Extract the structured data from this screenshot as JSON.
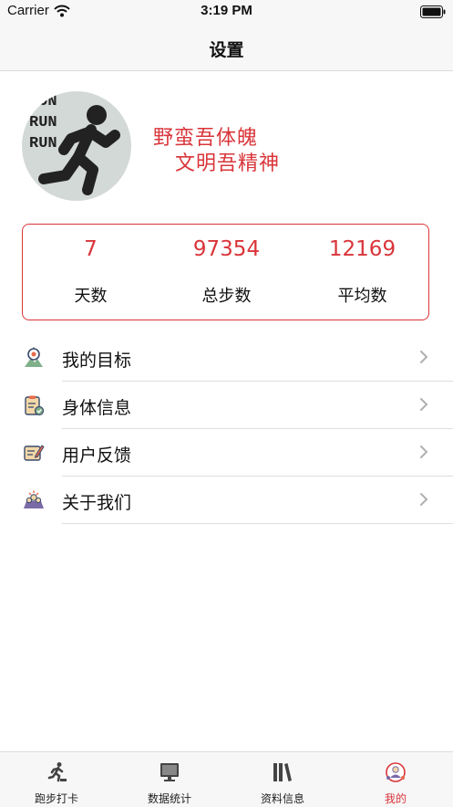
{
  "status": {
    "carrier": "Carrier",
    "time": "3:19 PM"
  },
  "nav": {
    "title": "设置"
  },
  "profile": {
    "avatar_words": [
      "RUN",
      "RUN",
      "RUN"
    ],
    "slogan_line1": "野蛮吾体魄",
    "slogan_line2": "文明吾精神"
  },
  "stats": [
    {
      "value": "7",
      "label": "天数"
    },
    {
      "value": "97354",
      "label": "总步数"
    },
    {
      "value": "12169",
      "label": "平均数"
    }
  ],
  "menu": [
    {
      "label": "我的目标",
      "icon": "target-icon"
    },
    {
      "label": "身体信息",
      "icon": "body-info-icon"
    },
    {
      "label": "用户反馈",
      "icon": "feedback-icon"
    },
    {
      "label": "关于我们",
      "icon": "about-us-icon"
    }
  ],
  "tabs": [
    {
      "label": "跑步打卡",
      "icon": "running-icon",
      "active": false
    },
    {
      "label": "数据统计",
      "icon": "monitor-icon",
      "active": false
    },
    {
      "label": "资料信息",
      "icon": "books-icon",
      "active": false
    },
    {
      "label": "我的",
      "icon": "profile-icon",
      "active": true
    }
  ],
  "colors": {
    "accent": "#d9353a",
    "bar_bg": "#f7f7f7",
    "divider": "#dedede",
    "avatar_bg": "#d3d9d6"
  }
}
